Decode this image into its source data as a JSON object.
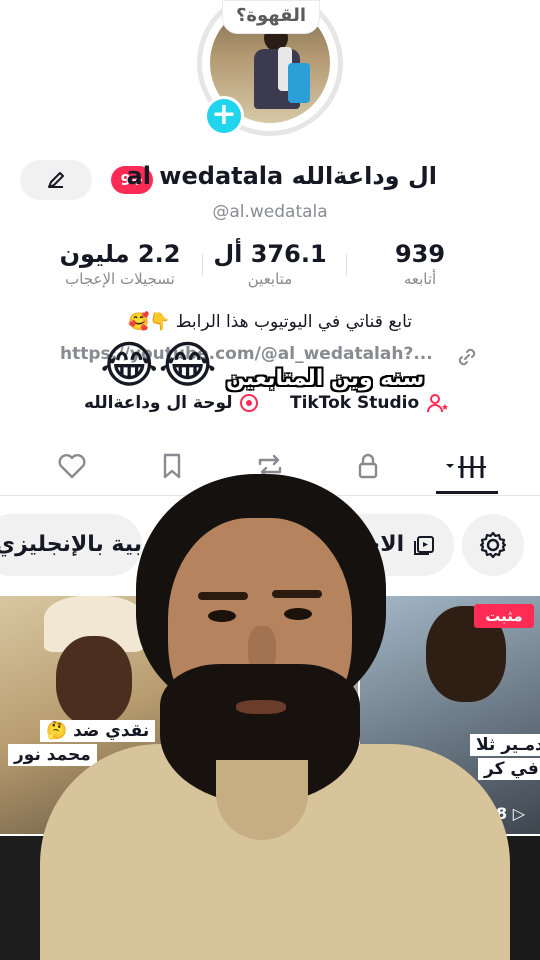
{
  "profile": {
    "avatar_bubble": "القهوة؟",
    "display_name": "ال وداعةالله al wedatala",
    "username": "@al.wedatala",
    "notification_badge": "9+"
  },
  "stats": {
    "following_value": "939",
    "following_label": "أتابعه",
    "followers_value": "376.1 أل",
    "followers_label": "متابعين",
    "likes_value": "2.2 مليون",
    "likes_label": "تسجيلات الإعجاب"
  },
  "bio": {
    "text": "تابع قناتي في اليوتيوب هذا الرابط 👇🥰",
    "link": "https://youtube.com/@al_wedatalah?..."
  },
  "tools": {
    "studio_label": "TikTok Studio",
    "dashboard_label": "لوحة ال وداعةالله"
  },
  "overlay": {
    "emojis": "😂😂",
    "caption": "سنه وين المتابعين"
  },
  "filters": {
    "english_chip": "بية بالإنجليزي",
    "events_chip": "الاحداث"
  },
  "grid": {
    "pinned_label": "مثبت",
    "cell1_caption_1": "نقدي ضد 🤔",
    "cell1_caption_2": "محمد نور",
    "cell3_caption_1": "تدمـير ثلا",
    "cell3_caption_2": "في كر",
    "cell3_views": "8"
  },
  "colors": {
    "accent_red": "#fe2c55",
    "accent_cyan": "#20d5ec",
    "text_primary": "#161823",
    "text_secondary": "#8a8b91"
  }
}
